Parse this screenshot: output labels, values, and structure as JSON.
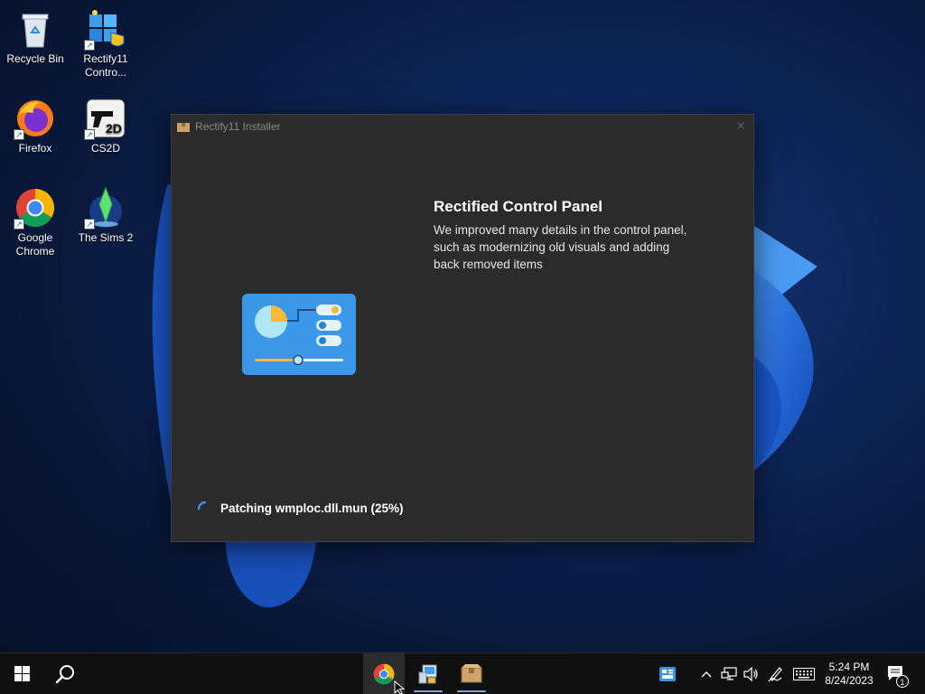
{
  "desktop": {
    "icons": [
      {
        "label": "Recycle Bin"
      },
      {
        "label": "Rectify11 Contro..."
      },
      {
        "label": "Firefox"
      },
      {
        "label": "CS2D"
      },
      {
        "label": "Google Chrome"
      },
      {
        "label": "The Sims 2"
      }
    ]
  },
  "window": {
    "title": "Rectify11 Installer",
    "heading": "Rectified Control Panel",
    "description": "We improved many details in the control panel, such as modernizing old visuals and adding back removed items",
    "status": "Patching wmploc.dll.mun (25%)",
    "progress_percent": 25
  },
  "taskbar": {
    "apps": [
      {
        "icon": "chrome-icon",
        "running": false
      },
      {
        "icon": "rectify11-control-center-icon",
        "running": true
      },
      {
        "icon": "installer-box-icon",
        "running": true
      }
    ],
    "clock": {
      "time": "5:24 PM",
      "date": "8/24/2023"
    },
    "notification_count": "1"
  },
  "colors": {
    "accent": "#3a95e6",
    "window_bg": "#2b2b2b",
    "taskbar_bg": "#101010"
  }
}
